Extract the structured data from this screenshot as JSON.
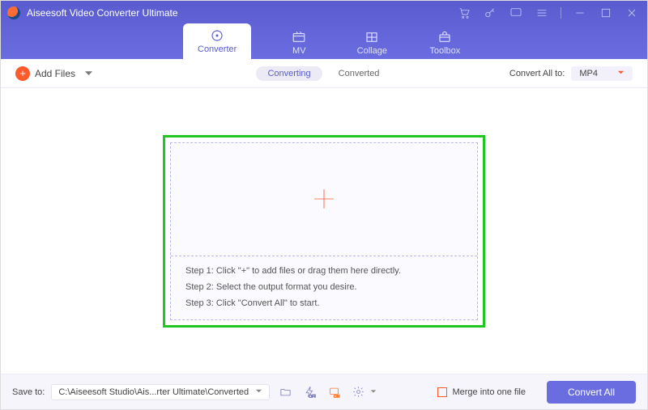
{
  "header": {
    "title": "Aiseesoft Video Converter Ultimate"
  },
  "tabs": [
    {
      "id": "converter",
      "label": "Converter",
      "active": true
    },
    {
      "id": "mv",
      "label": "MV",
      "active": false
    },
    {
      "id": "collage",
      "label": "Collage",
      "active": false
    },
    {
      "id": "toolbox",
      "label": "Toolbox",
      "active": false
    }
  ],
  "toolbar": {
    "add_files_label": "Add Files",
    "segment": {
      "converting": "Converting",
      "converted": "Converted",
      "active": "converting"
    },
    "convert_all_to_label": "Convert All to:",
    "format_selected": "MP4"
  },
  "dropzone": {
    "steps": [
      "Step 1: Click \"+\" to add files or drag them here directly.",
      "Step 2: Select the output format you desire.",
      "Step 3: Click \"Convert All\" to start."
    ]
  },
  "bottom": {
    "save_to_label": "Save to:",
    "save_path": "C:\\Aiseesoft Studio\\Ais...rter Ultimate\\Converted",
    "merge_label": "Merge into one file",
    "convert_all_label": "Convert All",
    "hw_badge": "OFF",
    "gpu_badge": "ON"
  },
  "icons": {
    "cart": "cart-icon",
    "key": "key-icon",
    "feedback": "feedback-icon",
    "menu": "menu-icon",
    "minimize": "minimize-icon",
    "maximize": "maximize-icon",
    "close": "close-icon"
  }
}
